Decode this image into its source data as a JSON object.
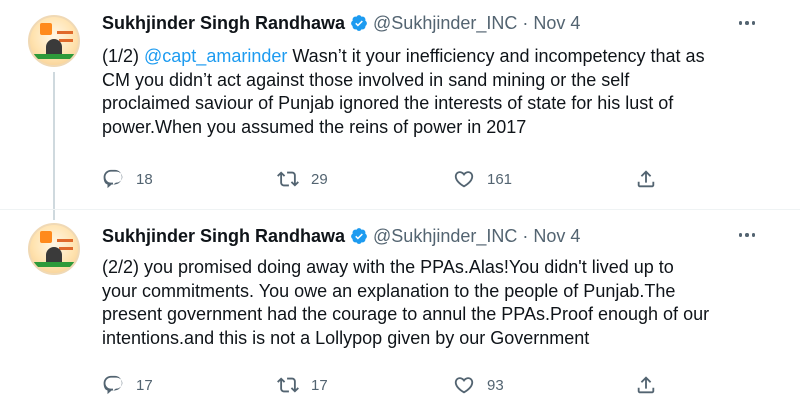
{
  "tweets": [
    {
      "author_name": "Sukhjinder Singh Randhawa",
      "handle": "@Sukhjinder_INC",
      "separator": "·",
      "date": "Nov 4",
      "mention": "@capt_amarinder",
      "lines": [
        "(1/2) ",
        "CM you didn’t act against those involved in sand mining or the self",
        "proclaimed saviour of Punjab ignored the interests of state for his lust of",
        "power.When you assumed the reins of power in 2017"
      ],
      "line1_rest": " Wasn’t it your inefficiency and incompetency that as",
      "replies": "18",
      "retweets": "29",
      "likes": "161"
    },
    {
      "author_name": "Sukhjinder Singh Randhawa",
      "handle": "@Sukhjinder_INC",
      "separator": "·",
      "date": "Nov 4",
      "lines": [
        "(2/2) you promised doing away with the PPAs.Alas!You didn't lived up to",
        "your commitments. You owe an explanation to the people of Punjab.The",
        "present government had the courage to annul the PPAs.Proof enough of our",
        "intentions.and this is not a Lollypop given by our Government"
      ],
      "replies": "17",
      "retweets": "17",
      "likes": "93"
    }
  ],
  "icons": {
    "verified": "verified-badge-icon",
    "more": "more-options-icon",
    "reply": "reply-icon",
    "retweet": "retweet-icon",
    "like": "heart-icon",
    "share": "share-icon"
  },
  "colors": {
    "accent": "#1d9bf0",
    "text": "#0f1419",
    "secondary": "#536471"
  }
}
